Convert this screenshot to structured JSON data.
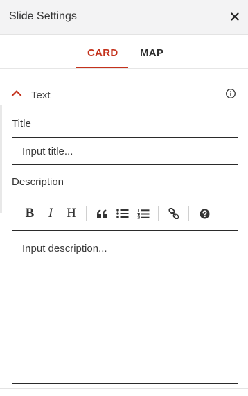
{
  "header": {
    "title": "Slide Settings",
    "close_icon": "close-icon"
  },
  "tabs": [
    {
      "label": "CARD",
      "active": true
    },
    {
      "label": "MAP",
      "active": false
    }
  ],
  "section": {
    "title": "Text",
    "expanded": true,
    "toggle_icon": "chevron-up-icon",
    "info_icon": "info-icon"
  },
  "fields": {
    "title_label": "Title",
    "title_placeholder": "Input title...",
    "description_label": "Description",
    "description_placeholder": "Input description..."
  },
  "toolbar": {
    "bold": "B",
    "italic": "I",
    "heading": "H",
    "icons": [
      "bold-icon",
      "italic-icon",
      "heading-icon",
      "quote-icon",
      "bulleted-list-icon",
      "numbered-list-icon",
      "link-icon",
      "help-icon"
    ]
  },
  "colors": {
    "accent": "#c4321c",
    "header_bg": "#f3f3f4",
    "border": "#2b2b2b"
  }
}
